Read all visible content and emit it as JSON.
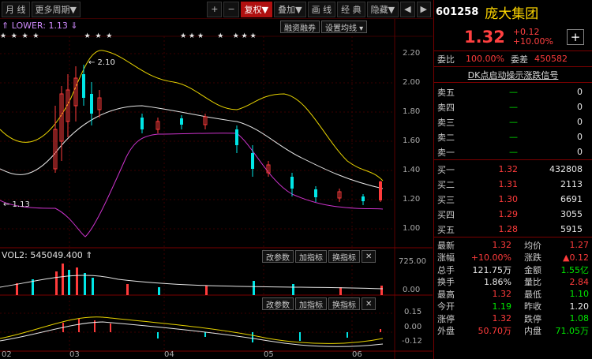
{
  "toolbar": {
    "period_day": "月 线",
    "more_periods": "更多周期▼",
    "plus": "+",
    "minus": "−",
    "fuquan": "复权▼",
    "overlay": "叠加▼",
    "draw_line": "画 线",
    "classic": "经 典",
    "hide": "隐藏▼",
    "prev": "◀",
    "next": "▶"
  },
  "chart": {
    "indicator": "⇑ LOWER: 1.13 ⇓",
    "btn_margin": "融资融券",
    "btn_ma": "设置均线 ▾",
    "high_label": "← 2.10",
    "low_label": "← 1.13",
    "vol_label": "VOL2: 545049.400 ⇑",
    "btn_change_params": "改参数",
    "btn_add_indicator": "加指标",
    "btn_switch_indicator": "换指标",
    "btn_close": "✕",
    "price_axis": [
      "2.20",
      "2.00",
      "1.80",
      "1.60",
      "1.40",
      "1.20",
      "1.00"
    ],
    "vol_axis": [
      "725.00",
      "0.00"
    ],
    "macd_axis": [
      "0.15",
      "0.00",
      "-0.12"
    ],
    "x_axis": [
      "02",
      "03",
      "04",
      "05",
      "06"
    ],
    "stars": "★  ★  ★  ★                    ★  ★  ★                              ★ ★ ★      ★    ★ ★ ★"
  },
  "colors": {
    "up": "#ff3b3b",
    "down": "#00e6e6",
    "ma_white": "#e6e6e6",
    "band_yellow": "#e6d200",
    "band_magenta": "#cc33cc"
  },
  "quote": {
    "code": "601258",
    "name": "庞大集团",
    "price": "1.32",
    "change": "+0.12",
    "change_pct": "+10.00%",
    "weibi_label": "委比",
    "weibi": "100.00%",
    "weicha_label": "委差",
    "weicha": "450582",
    "signal": "DK点启动操示涨跌信号",
    "asks": [
      {
        "label": "卖五",
        "price": "—",
        "vol": "0"
      },
      {
        "label": "卖四",
        "price": "—",
        "vol": "0"
      },
      {
        "label": "卖三",
        "price": "—",
        "vol": "0"
      },
      {
        "label": "卖二",
        "price": "—",
        "vol": "0"
      },
      {
        "label": "卖一",
        "price": "—",
        "vol": "0"
      }
    ],
    "bids": [
      {
        "label": "买一",
        "price": "1.32",
        "vol": "432808"
      },
      {
        "label": "买二",
        "price": "1.31",
        "vol": "2113"
      },
      {
        "label": "买三",
        "price": "1.30",
        "vol": "6691"
      },
      {
        "label": "买四",
        "price": "1.29",
        "vol": "3055"
      },
      {
        "label": "买五",
        "price": "1.28",
        "vol": "5915"
      }
    ],
    "stats": [
      {
        "a": "最新",
        "b": "1.32",
        "bc": "red",
        "c": "均价",
        "d": "1.27",
        "dc": "red"
      },
      {
        "a": "涨幅",
        "b": "+10.00%",
        "bc": "red",
        "c": "涨跌",
        "d": "▲0.12",
        "dc": "red"
      },
      {
        "a": "总手",
        "b": "121.75万",
        "bc": "white",
        "c": "金额",
        "d": "1.55亿",
        "dc": "green"
      },
      {
        "a": "换手",
        "b": "1.86%",
        "bc": "white",
        "c": "量比",
        "d": "2.84",
        "dc": "red"
      },
      {
        "a": "最高",
        "b": "1.32",
        "bc": "red",
        "c": "最低",
        "d": "1.10",
        "dc": "green"
      },
      {
        "a": "今开",
        "b": "1.19",
        "bc": "green",
        "c": "昨收",
        "d": "1.20",
        "dc": "white"
      },
      {
        "a": "涨停",
        "b": "1.32",
        "bc": "red",
        "c": "跌停",
        "d": "1.08",
        "dc": "green"
      },
      {
        "a": "外盘",
        "b": "50.70万",
        "bc": "red",
        "c": "内盘",
        "d": "71.05万",
        "dc": "green"
      }
    ]
  }
}
